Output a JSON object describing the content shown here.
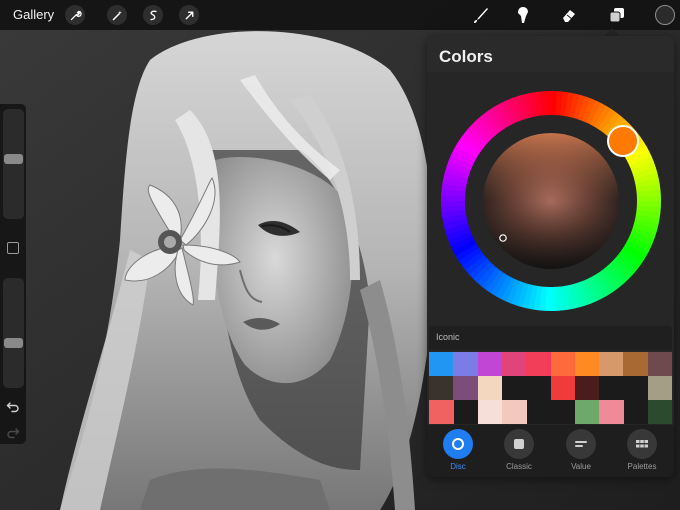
{
  "topbar": {
    "gallery_label": "Gallery",
    "left_tools": [
      "wrench-icon",
      "magic-wand-icon",
      "selection-icon",
      "transform-arrow-icon"
    ],
    "right_tools": [
      "brush-icon",
      "smudge-icon",
      "eraser-icon",
      "layers-icon"
    ],
    "current_color": "#2b2b2b"
  },
  "sidebar": {
    "brush_size_level": 0.55,
    "opacity_level": 0.4
  },
  "colors_panel": {
    "title": "Colors",
    "selected_hue": "#ff7a00",
    "palette_name": "Iconic",
    "palette_rows": [
      [
        "#2196f3",
        "#7c7ce6",
        "#c246d6",
        "#e0457a",
        "#f23e58",
        "#ff6a3d",
        "#ff8a24",
        "#d69a6a",
        "#a86a32",
        "#6e4a4e"
      ],
      [
        "#3a322d",
        "#7c4d78",
        "#f3d7bf",
        "",
        "",
        "#ef3b3b",
        "#4a1c1c",
        "",
        "",
        "#a59e86"
      ],
      [
        "#f06262",
        "",
        "#f6dfd8",
        "#f3c9bf",
        "",
        "",
        "#6ea86a",
        "#f08a98",
        "",
        "#2c4a2e"
      ]
    ],
    "tabs": [
      {
        "label": "Disc",
        "icon": "disc-icon",
        "active": true
      },
      {
        "label": "Classic",
        "icon": "classic-square-icon",
        "active": false
      },
      {
        "label": "Value",
        "icon": "value-sliders-icon",
        "active": false
      },
      {
        "label": "Palettes",
        "icon": "palettes-grid-icon",
        "active": false
      }
    ]
  }
}
